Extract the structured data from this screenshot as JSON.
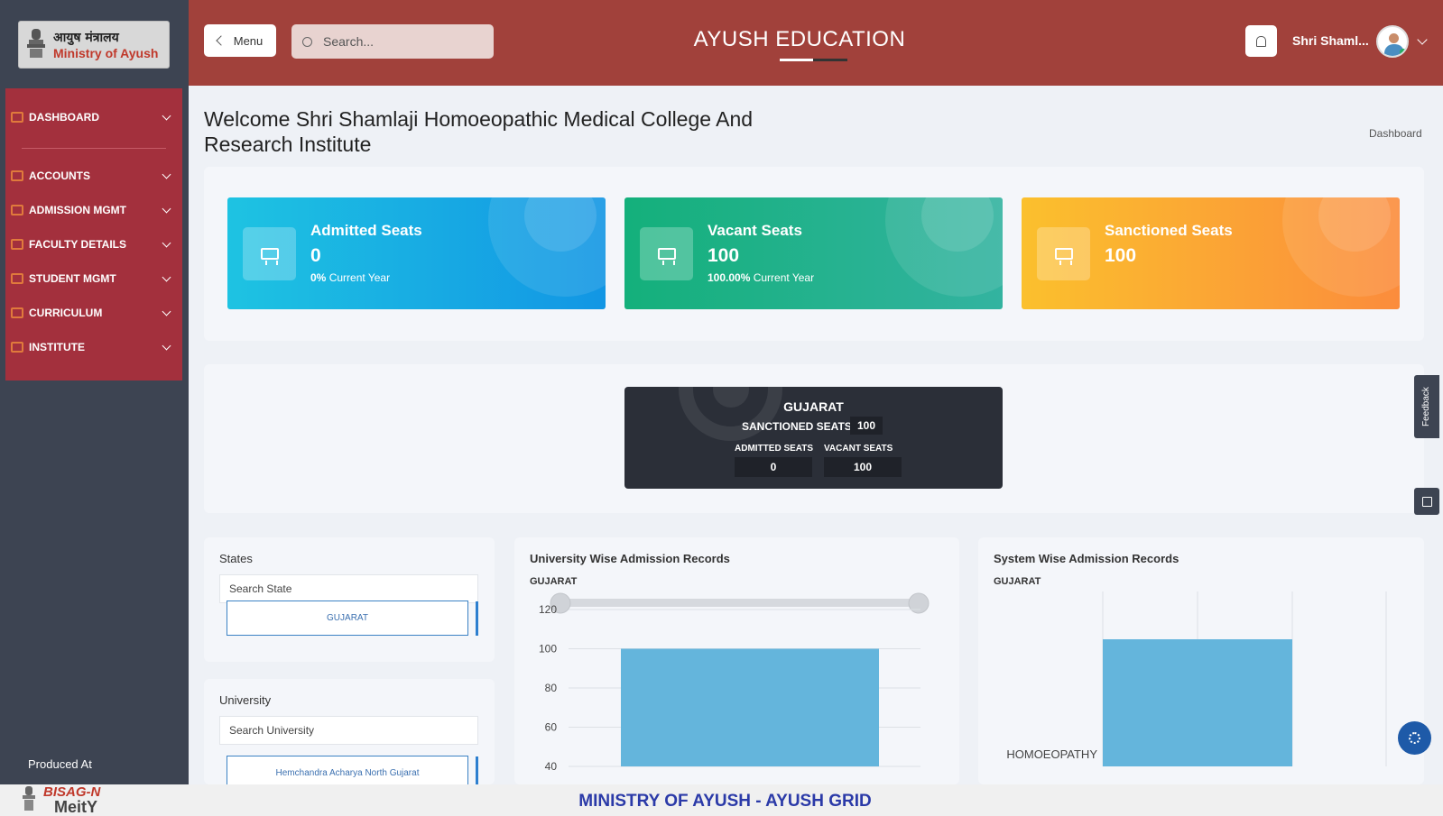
{
  "logo": {
    "hindi": "आयुष मंत्रालय",
    "english": "Ministry of Ayush"
  },
  "sidebar": {
    "items": [
      {
        "label": "DASHBOARD"
      },
      {
        "label": "ACCOUNTS"
      },
      {
        "label": "ADMISSION MGMT"
      },
      {
        "label": "FACULTY DETAILS"
      },
      {
        "label": "STUDENT MGMT"
      },
      {
        "label": "CURRICULUM"
      },
      {
        "label": "INSTITUTE"
      }
    ],
    "produced_at": "Produced At"
  },
  "header": {
    "menu_label": "Menu",
    "search_placeholder": "Search...",
    "title": "AYUSH EDUCATION",
    "user_name": "Shri Shaml..."
  },
  "page": {
    "welcome": "Welcome Shri Shamlaji Homoeopathic Medical College And Research Institute",
    "breadcrumb": "Dashboard"
  },
  "stats": {
    "admitted": {
      "title": "Admitted Seats",
      "value": "0",
      "pct": "0%",
      "suffix": "Current Year"
    },
    "vacant": {
      "title": "Vacant Seats",
      "value": "100",
      "pct": "100.00%",
      "suffix": "Current Year"
    },
    "sanctioned": {
      "title": "Sanctioned Seats",
      "value": "100"
    }
  },
  "state_summary": {
    "name": "GUJARAT",
    "sanctioned_label": "SANCTIONED SEATS",
    "sanctioned_value": "100",
    "admitted_label": "ADMITTED SEATS",
    "admitted_value": "0",
    "vacant_label": "VACANT SEATS",
    "vacant_value": "100"
  },
  "states_panel": {
    "title": "States",
    "search_placeholder": "Search State",
    "option": "GUJARAT"
  },
  "university_panel": {
    "title": "University",
    "search_placeholder": "Search University",
    "option": "Hemchandra Acharya North Gujarat"
  },
  "uni_chart": {
    "title": "University Wise Admission Records",
    "subtitle": "GUJARAT"
  },
  "sys_chart": {
    "title": "System Wise Admission Records",
    "subtitle": "GUJARAT"
  },
  "side_tools": {
    "feedback": "Feedback"
  },
  "footer": {
    "brand": "BISAG-N",
    "meity": "MeitY",
    "text": "MINISTRY OF AYUSH - AYUSH GRID"
  },
  "colors": {
    "header": "#a1413b",
    "sidebar": "#3d4452",
    "menu_panel": "#a3303d",
    "bar": "#64b5dc"
  },
  "chart_data": [
    {
      "type": "bar",
      "title": "University Wise Admission Records",
      "subtitle": "GUJARAT",
      "categories": [
        ""
      ],
      "values": [
        100
      ],
      "yticks": [
        40,
        60,
        80,
        100,
        120
      ],
      "ylim": [
        40,
        120
      ],
      "grid": true,
      "range_slider": true
    },
    {
      "type": "bar",
      "orientation": "horizontal",
      "title": "System Wise Admission Records",
      "subtitle": "GUJARAT",
      "categories": [
        "HOMOEOPATHY"
      ],
      "values": [
        100
      ],
      "grid": true
    }
  ]
}
